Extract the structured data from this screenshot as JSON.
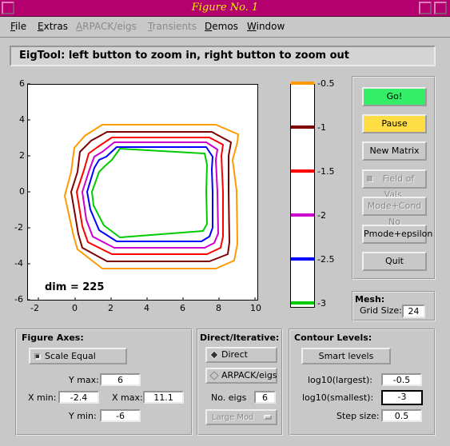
{
  "window": {
    "title": "Figure No. 1"
  },
  "menu": [
    "File",
    "Extras",
    "ARPACK/eigs",
    "Transients",
    "Demos",
    "Window"
  ],
  "message": "EigTool: left button to zoom in, right button to zoom out",
  "plot": {
    "x_ticks": [
      "-2",
      "0",
      "2",
      "4",
      "6",
      "8",
      "10"
    ],
    "y_ticks": [
      "6",
      "4",
      "2",
      "0",
      "-2",
      "-4",
      "-6"
    ],
    "dim_label": "dim = 225"
  },
  "colorbar": {
    "levels": [
      "-0.5",
      "-1",
      "-1.5",
      "-2",
      "-2.5",
      "-3"
    ],
    "colors": [
      "#ff9900",
      "#800000",
      "#ff0000",
      "#cc00cc",
      "#0000ff",
      "#00cc00"
    ]
  },
  "buttons": {
    "go": "Go!",
    "pause": "Pause",
    "new_matrix": "New Matrix",
    "field_of_vals": "Field of Vals.",
    "mode_cond": "Mode+Cond No",
    "pmode": "Pmode+epsilon",
    "quit": "Quit"
  },
  "mesh": {
    "title": "Mesh:",
    "grid_size_label": "Grid Size:",
    "grid_size": "24"
  },
  "figure_axes": {
    "title": "Figure Axes:",
    "scale_equal": "Scale Equal",
    "ymax_label": "Y max:",
    "ymax": "6",
    "xmin_label": "X min:",
    "xmin": "-2.4",
    "xmax_label": "X max:",
    "xmax": "11.1",
    "ymin_label": "Y min:",
    "ymin": "-6"
  },
  "direct": {
    "title": "Direct/Iterative:",
    "direct": "Direct",
    "arpack": "ARPACK/eigs",
    "no_eigs_label": "No. eigs",
    "no_eigs": "6",
    "which": "Large Mod"
  },
  "contour": {
    "title": "Contour Levels:",
    "smart": "Smart levels",
    "largest_label": "log10(largest):",
    "largest": "-0.5",
    "smallest_label": "log10(smallest):",
    "smallest": "-3",
    "step_label": "Step size:",
    "step": "0.5"
  }
}
